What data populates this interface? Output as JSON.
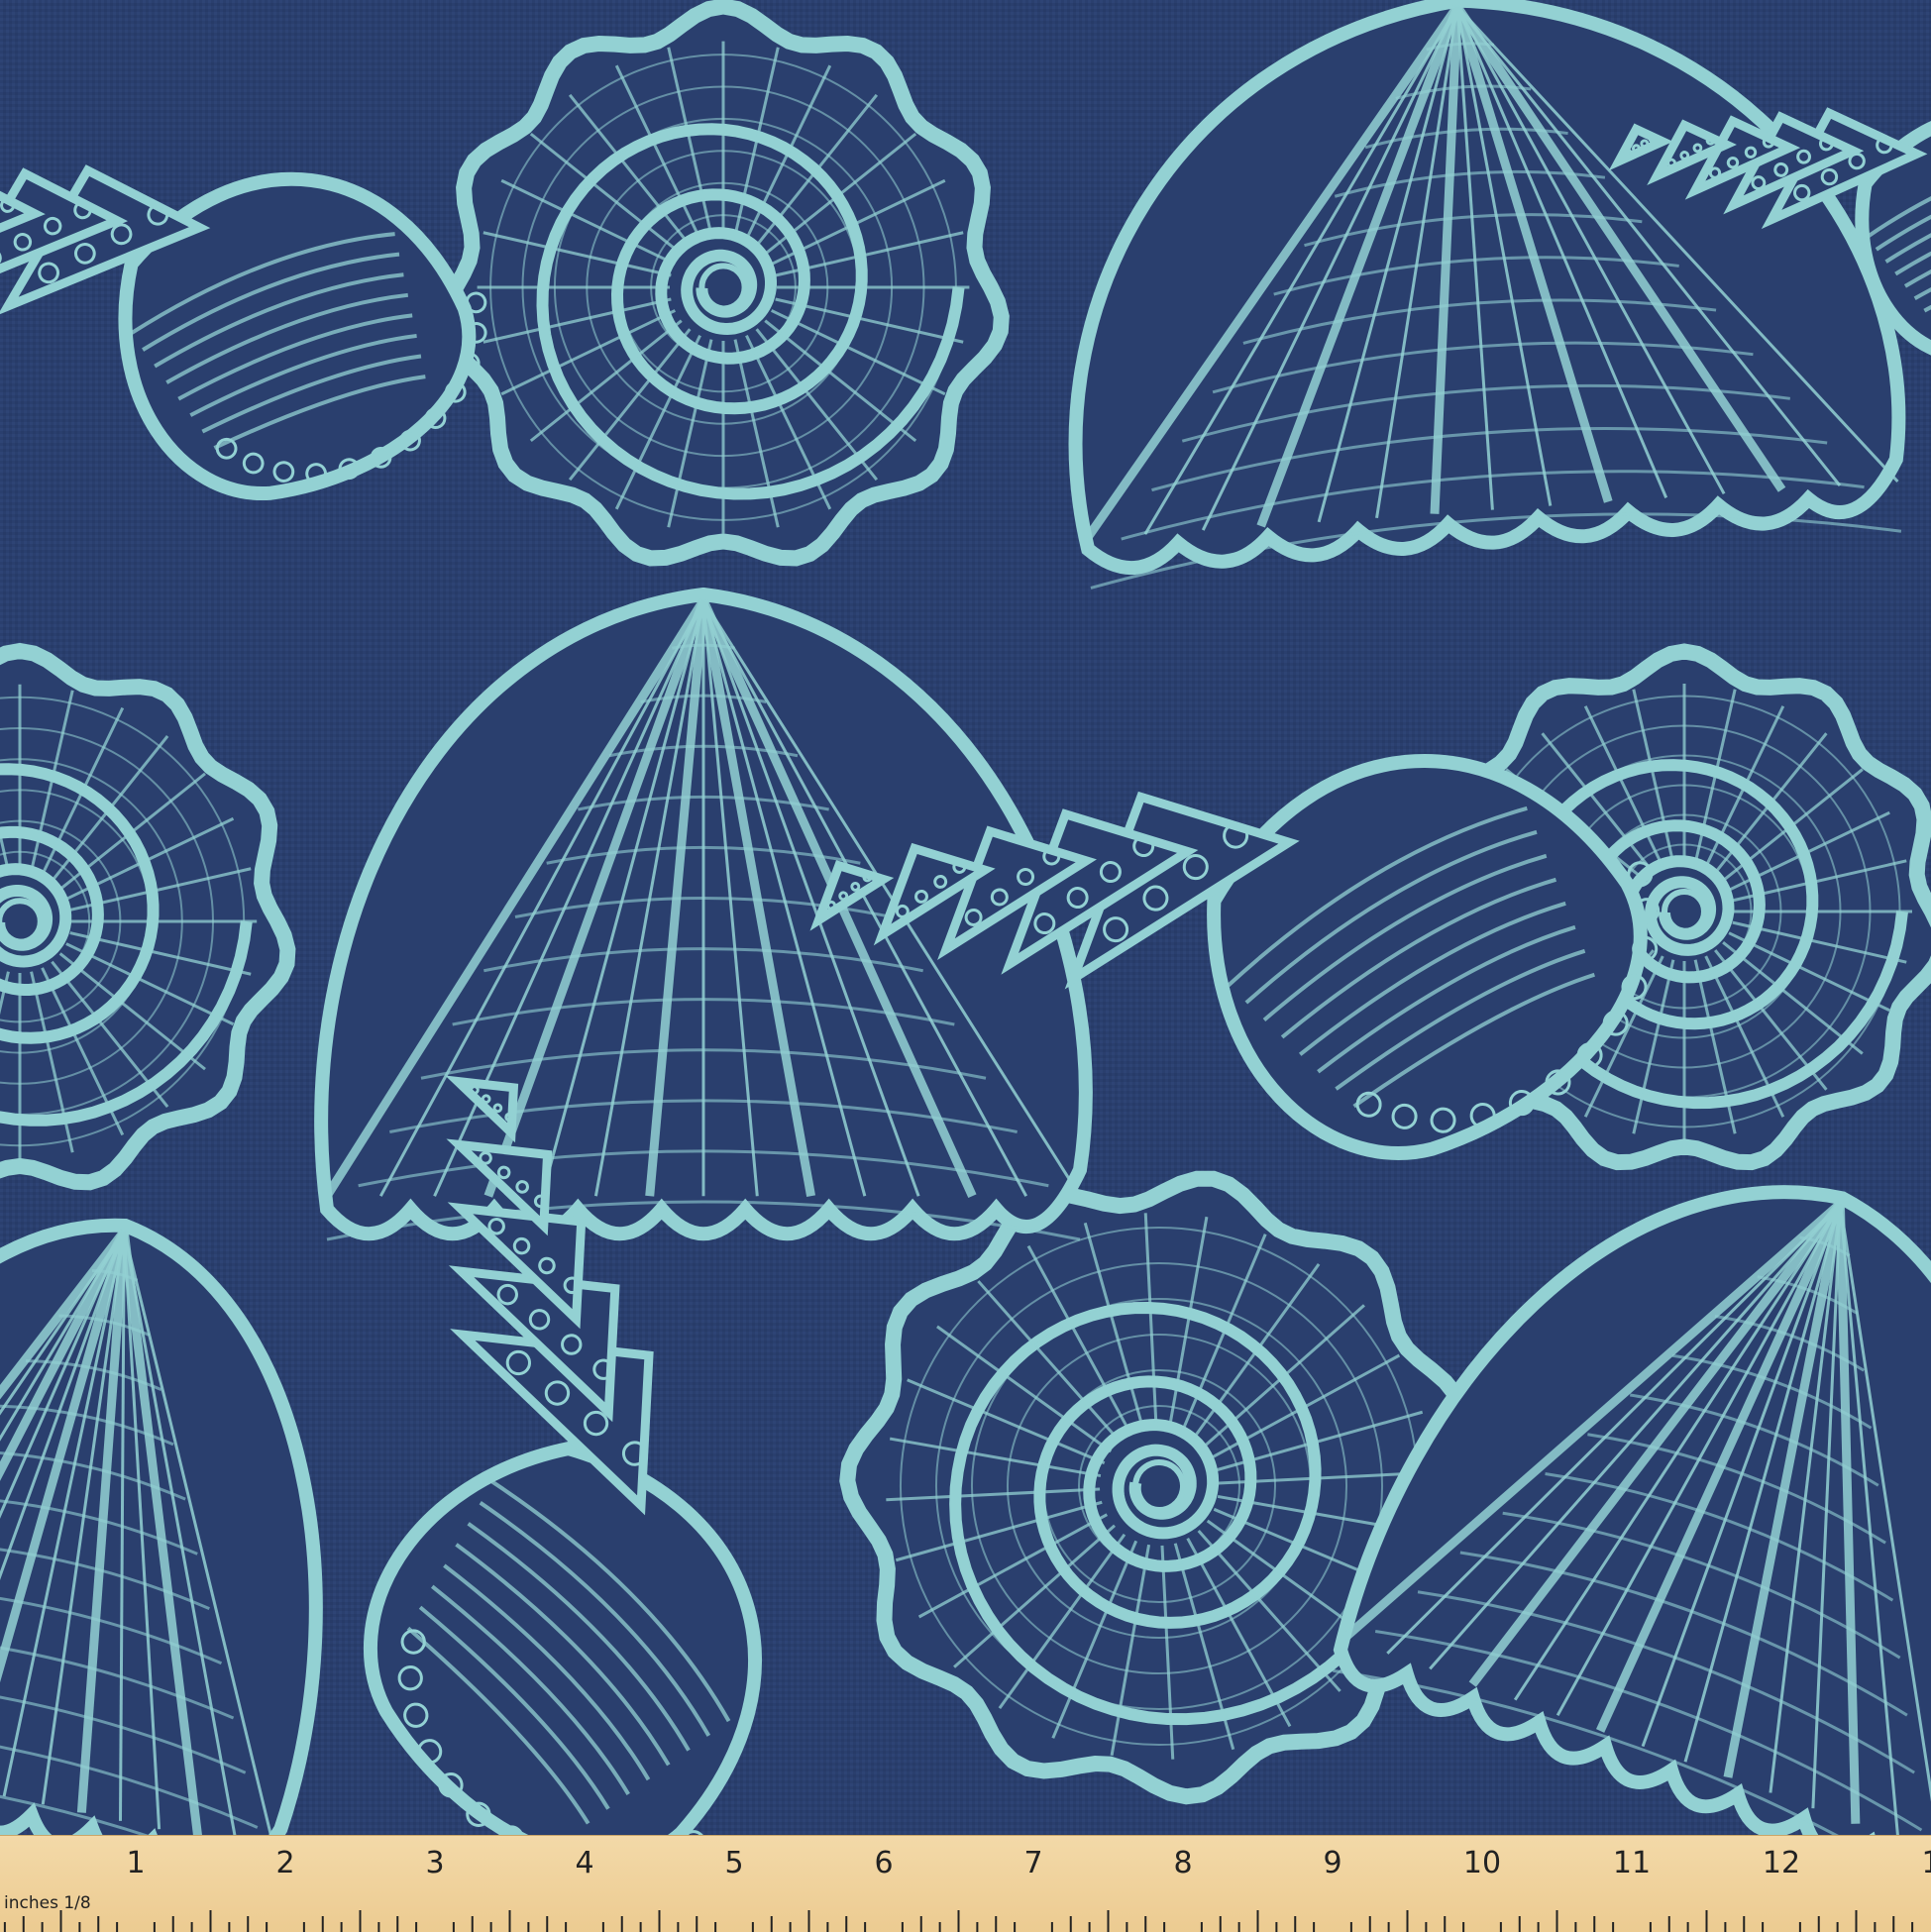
{
  "colors": {
    "background": "#2a3f6e",
    "shell_line": "#93d1d3",
    "ruler": "#f0d39e",
    "ruler_text": "#222222"
  },
  "shells": [
    {
      "kind": "spiral-shell-icon"
    },
    {
      "kind": "scallop-shell-icon"
    },
    {
      "kind": "conch-shell-icon"
    }
  ],
  "ruler": {
    "unit_label": "inches 1/8",
    "numbers": [
      "1",
      "2",
      "3",
      "4",
      "5",
      "6",
      "7",
      "8",
      "9",
      "10",
      "11",
      "12",
      "1"
    ]
  }
}
